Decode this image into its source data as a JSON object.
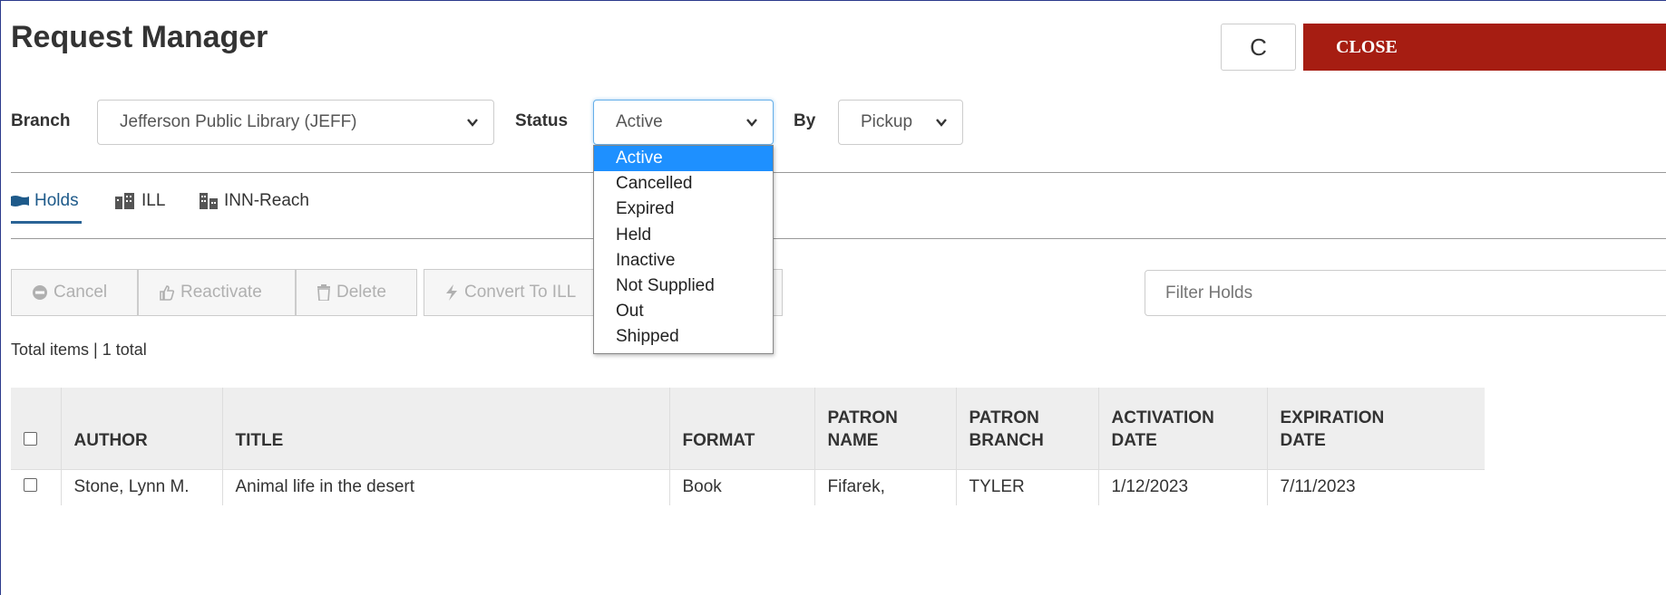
{
  "header": {
    "title": "Request Manager",
    "refresh_glyph": "C",
    "close_label": "CLOSE"
  },
  "filters": {
    "branch_label": "Branch",
    "branch_value": "Jefferson Public Library (JEFF)",
    "status_label": "Status",
    "status_value": "Active",
    "by_label": "By",
    "by_value": "Pickup"
  },
  "status_dropdown": {
    "options": [
      "Active",
      "Cancelled",
      "Expired",
      "Held",
      "Inactive",
      "Not Supplied",
      "Out",
      "Shipped"
    ],
    "selected": "Active"
  },
  "tabs": [
    {
      "label": "Holds",
      "icon": "flag-icon",
      "active": true
    },
    {
      "label": "ILL",
      "icon": "building-icon",
      "active": false
    },
    {
      "label": "INN-Reach",
      "icon": "building-network-icon",
      "active": false
    }
  ],
  "toolbar": {
    "cancel": "Cancel",
    "reactivate": "Reactivate",
    "delete": "Delete",
    "convert": "Convert To ILL",
    "filter_placeholder": "Filter Holds"
  },
  "summary": "Total items | 1 total",
  "table": {
    "columns": [
      "AUTHOR",
      "TITLE",
      "FORMAT",
      "PATRON NAME",
      "PATRON BRANCH",
      "ACTIVATION DATE",
      "EXPIRATION DATE"
    ],
    "rows": [
      [
        "Stone, Lynn M.",
        "Animal life in the desert",
        "Book",
        "Fifarek,",
        "TYLER",
        "1/12/2023",
        "7/11/2023"
      ]
    ]
  },
  "colors": {
    "close_bg": "#a61d12",
    "selected_option": "#1e90ff",
    "active_tab": "#2a6496"
  }
}
